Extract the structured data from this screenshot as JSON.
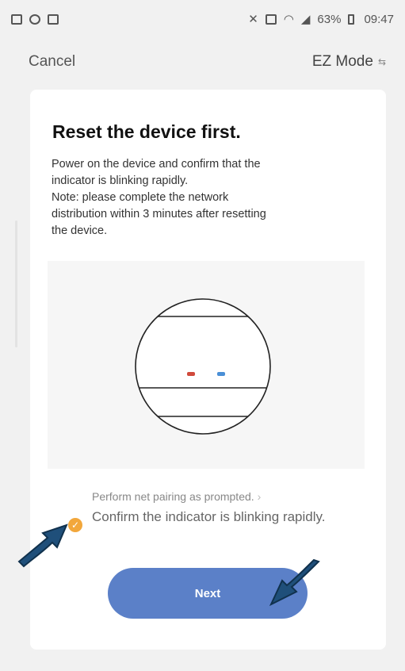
{
  "status_bar": {
    "signal_text": "63%",
    "time": "09:47",
    "icons": [
      "gallery-icon",
      "android-icon",
      "notes-icon",
      "mute-icon",
      "nfc-icon",
      "wifi-icon",
      "signal-icon",
      "battery-icon"
    ]
  },
  "nav": {
    "cancel_label": "Cancel",
    "mode_label": "EZ Mode",
    "mode_icon": "swap-icon"
  },
  "content": {
    "title": "Reset the device first.",
    "description_lines": [
      "Power on the device and confirm that the",
      "indicator is blinking rapidly.",
      "Note: please complete the network",
      "distribution within 3 minutes after resetting",
      "the device."
    ],
    "pairing_link": "Perform net pairing as prompted.",
    "confirm_text": "Confirm the indicator is blinking rapidly.",
    "confirm_checked": true,
    "next_label": "Next"
  },
  "colors": {
    "accent": "#5b80c8",
    "check": "#f2a73b",
    "annotation_arrow": "#1f4f7a",
    "led_red": "#d04a3c",
    "led_blue": "#4a8fd6"
  }
}
